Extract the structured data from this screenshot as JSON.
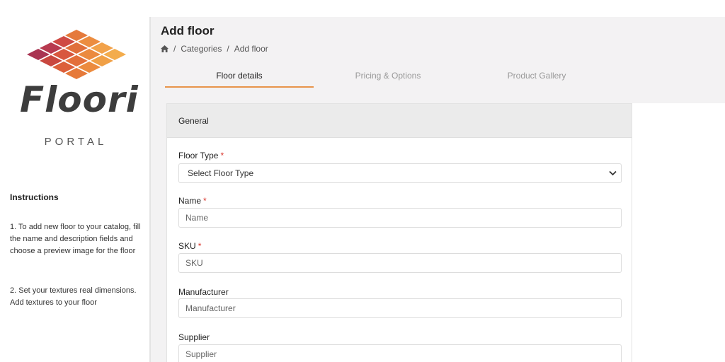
{
  "brand": {
    "name": "Floori",
    "subtitle": "PORTAL",
    "tile_colors": [
      "#b53a4e",
      "#d3553d",
      "#e97a3b",
      "#f0a04a"
    ]
  },
  "instructions": {
    "title": "Instructions",
    "items": [
      "1. To add new floor to your catalog, fill the name and description fields and choose a preview image for the floor",
      "2. Set your textures real dimensions. Add textures to your floor"
    ]
  },
  "page": {
    "title": "Add floor",
    "breadcrumb": [
      "Categories",
      "Add floor"
    ],
    "breadcrumb_separator": "/"
  },
  "tabs": [
    {
      "label": "Floor details",
      "active": true
    },
    {
      "label": "Pricing & Options",
      "active": false
    },
    {
      "label": "Product Gallery",
      "active": false
    }
  ],
  "form": {
    "section_title": "General",
    "floor_type": {
      "label": "Floor Type",
      "required_mark": "*",
      "value": "Select Floor Type"
    },
    "name": {
      "label": "Name",
      "required_mark": "*",
      "placeholder": "Name"
    },
    "sku": {
      "label": "SKU",
      "required_mark": "*",
      "placeholder": "SKU"
    },
    "manufacturer": {
      "label": "Manufacturer",
      "placeholder": "Manufacturer"
    },
    "supplier": {
      "label": "Supplier",
      "placeholder": "Supplier"
    }
  },
  "colors": {
    "accent": "#e8944a",
    "required": "#d9342b",
    "background": "#f3f2f3"
  }
}
